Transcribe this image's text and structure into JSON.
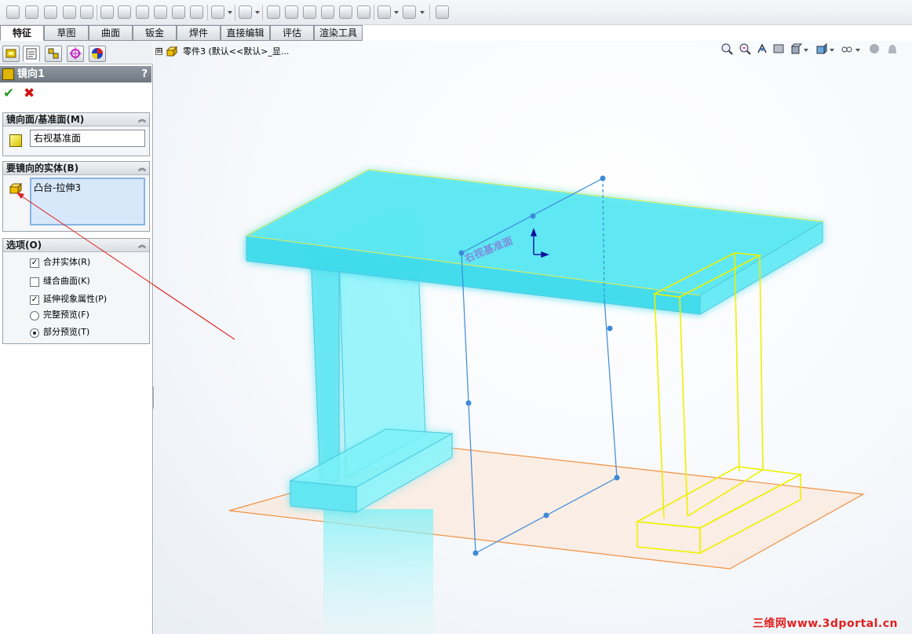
{
  "tabs": [
    "特征",
    "草图",
    "曲面",
    "钣金",
    "焊件",
    "直接编辑",
    "评估",
    "渲染工具"
  ],
  "active_tab": "特征",
  "tree": {
    "expand_symbol": "⊞",
    "root_label": "零件3 (默认<<默认>_显..."
  },
  "property_manager": {
    "title": "镜向1",
    "help": "?",
    "ok": "✔",
    "cancel": "✖",
    "mirror_face_group": {
      "label": "镜向面/基准面(M)",
      "value": "右视基准面"
    },
    "bodies_group": {
      "label": "要镜向的实体(B)",
      "items": [
        "凸台-拉伸3"
      ]
    },
    "options_group": {
      "label": "选项(O)",
      "merge_solids": {
        "label": "合并实体(R)",
        "checked": true
      },
      "knit_surfaces": {
        "label": "缝合曲面(K)",
        "checked": false
      },
      "propagate_visual": {
        "label": "延伸视象属性(P)",
        "checked": true
      },
      "full_preview": {
        "label": "完整预览(F)",
        "selected": false
      },
      "partial_preview": {
        "label": "部分预览(T)",
        "selected": true
      }
    }
  },
  "viewport": {
    "plane_label": "右视基准面",
    "watermark": "三维网www.3dportal.cn"
  },
  "colors": {
    "accent_cyan": "#55e8f2",
    "preview_yellow": "#f0f000",
    "plane_orange": "#f09040",
    "arrow_red": "#e02020"
  },
  "check_mark": "✓"
}
